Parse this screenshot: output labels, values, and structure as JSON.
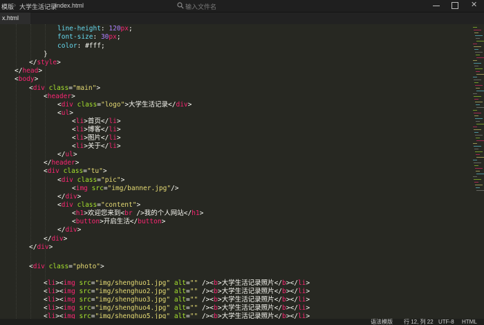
{
  "breadcrumb": {
    "items": [
      "模版",
      "大学生活记录",
      "index.html"
    ]
  },
  "search": {
    "placeholder": "输入文件名"
  },
  "tabs": [
    {
      "label": "x.html"
    }
  ],
  "code_lines": [
    [
      [
        "prop",
        "line-height"
      ],
      [
        "txt",
        ": "
      ],
      [
        "num",
        "120"
      ],
      [
        "tag",
        "px"
      ],
      [
        "txt",
        ";"
      ]
    ],
    [
      [
        "prop",
        "font-size"
      ],
      [
        "txt",
        ": "
      ],
      [
        "num",
        "30"
      ],
      [
        "tag",
        "px"
      ],
      [
        "txt",
        ";"
      ]
    ],
    [
      [
        "prop",
        "color"
      ],
      [
        "txt",
        ": "
      ],
      [
        "txt",
        "#fff"
      ],
      [
        "txt",
        ";"
      ]
    ],
    [
      [
        "txt",
        "}"
      ]
    ],
    [
      [
        "txt",
        "</"
      ],
      [
        "tag",
        "style"
      ],
      [
        "txt",
        ">"
      ]
    ],
    [
      [
        "txt",
        "</"
      ],
      [
        "tag",
        "head"
      ],
      [
        "txt",
        ">"
      ]
    ],
    [
      [
        "txt",
        "<"
      ],
      [
        "tag",
        "body"
      ],
      [
        "txt",
        ">"
      ]
    ],
    [
      [
        "txt",
        "<"
      ],
      [
        "tag",
        "div"
      ],
      [
        "txt",
        " "
      ],
      [
        "attr",
        "class"
      ],
      [
        "txt",
        "="
      ],
      [
        "str",
        "\"main\""
      ],
      [
        "txt",
        ">"
      ]
    ],
    [
      [
        "txt",
        "<"
      ],
      [
        "tag",
        "header"
      ],
      [
        "txt",
        ">"
      ]
    ],
    [
      [
        "txt",
        "<"
      ],
      [
        "tag",
        "div"
      ],
      [
        "txt",
        " "
      ],
      [
        "attr",
        "class"
      ],
      [
        "txt",
        "="
      ],
      [
        "str",
        "\"logo\""
      ],
      [
        "txt",
        ">大学生活记录</"
      ],
      [
        "tag",
        "div"
      ],
      [
        "txt",
        ">"
      ]
    ],
    [
      [
        "txt",
        "<"
      ],
      [
        "tag",
        "ul"
      ],
      [
        "txt",
        ">"
      ]
    ],
    [
      [
        "txt",
        "<"
      ],
      [
        "tag",
        "li"
      ],
      [
        "txt",
        ">首页</"
      ],
      [
        "tag",
        "li"
      ],
      [
        "txt",
        ">"
      ]
    ],
    [
      [
        "txt",
        "<"
      ],
      [
        "tag",
        "li"
      ],
      [
        "txt",
        ">博客</"
      ],
      [
        "tag",
        "li"
      ],
      [
        "txt",
        ">"
      ]
    ],
    [
      [
        "txt",
        "<"
      ],
      [
        "tag",
        "li"
      ],
      [
        "txt",
        ">图片</"
      ],
      [
        "tag",
        "li"
      ],
      [
        "txt",
        ">"
      ]
    ],
    [
      [
        "txt",
        "<"
      ],
      [
        "tag",
        "li"
      ],
      [
        "txt",
        ">关于</"
      ],
      [
        "tag",
        "li"
      ],
      [
        "txt",
        ">"
      ]
    ],
    [
      [
        "txt",
        "</"
      ],
      [
        "tag",
        "ul"
      ],
      [
        "txt",
        ">"
      ]
    ],
    [
      [
        "txt",
        "</"
      ],
      [
        "tag",
        "header"
      ],
      [
        "txt",
        ">"
      ]
    ],
    [
      [
        "txt",
        "<"
      ],
      [
        "tag",
        "div"
      ],
      [
        "txt",
        " "
      ],
      [
        "attr",
        "class"
      ],
      [
        "txt",
        "="
      ],
      [
        "str",
        "\"tu\""
      ],
      [
        "txt",
        ">"
      ]
    ],
    [
      [
        "txt",
        "<"
      ],
      [
        "tag",
        "div"
      ],
      [
        "txt",
        " "
      ],
      [
        "attr",
        "class"
      ],
      [
        "txt",
        "="
      ],
      [
        "str",
        "\"pic\""
      ],
      [
        "txt",
        ">"
      ]
    ],
    [
      [
        "txt",
        "<"
      ],
      [
        "tag",
        "img"
      ],
      [
        "txt",
        " "
      ],
      [
        "attr",
        "src"
      ],
      [
        "txt",
        "="
      ],
      [
        "str",
        "\"img/banner.jpg\""
      ],
      [
        "txt",
        "/>"
      ]
    ],
    [
      [
        "txt",
        "</"
      ],
      [
        "tag",
        "div"
      ],
      [
        "txt",
        ">"
      ]
    ],
    [
      [
        "txt",
        "<"
      ],
      [
        "tag",
        "div"
      ],
      [
        "txt",
        " "
      ],
      [
        "attr",
        "class"
      ],
      [
        "txt",
        "="
      ],
      [
        "str",
        "\"content\""
      ],
      [
        "txt",
        ">"
      ]
    ],
    [
      [
        "txt",
        "<"
      ],
      [
        "tag",
        "h1"
      ],
      [
        "txt",
        ">欢迎您来到<"
      ],
      [
        "tag",
        "br"
      ],
      [
        "txt",
        " />我的个人网站</"
      ],
      [
        "tag",
        "h1"
      ],
      [
        "txt",
        ">"
      ]
    ],
    [
      [
        "txt",
        "<"
      ],
      [
        "tag",
        "button"
      ],
      [
        "txt",
        ">开启生活</"
      ],
      [
        "tag",
        "button"
      ],
      [
        "txt",
        ">"
      ]
    ],
    [
      [
        "txt",
        "</"
      ],
      [
        "tag",
        "div"
      ],
      [
        "txt",
        ">"
      ]
    ],
    [
      [
        "txt",
        "</"
      ],
      [
        "tag",
        "div"
      ],
      [
        "txt",
        ">"
      ]
    ],
    [
      [
        "txt",
        "</"
      ],
      [
        "tag",
        "div"
      ],
      [
        "txt",
        ">"
      ]
    ],
    [],
    [
      [
        "txt",
        "<"
      ],
      [
        "tag",
        "div"
      ],
      [
        "txt",
        " "
      ],
      [
        "attr",
        "class"
      ],
      [
        "txt",
        "="
      ],
      [
        "str",
        "\"photo\""
      ],
      [
        "txt",
        ">"
      ]
    ],
    [],
    [
      [
        "txt",
        "<"
      ],
      [
        "tag",
        "li"
      ],
      [
        "txt",
        "><"
      ],
      [
        "tag",
        "img"
      ],
      [
        "txt",
        " "
      ],
      [
        "attr",
        "src"
      ],
      [
        "txt",
        "="
      ],
      [
        "str",
        "\"img/shenghuo1.jpg\""
      ],
      [
        "txt",
        " "
      ],
      [
        "attr",
        "alt"
      ],
      [
        "txt",
        "="
      ],
      [
        "str",
        "\"\""
      ],
      [
        "txt",
        " /><"
      ],
      [
        "tag",
        "b"
      ],
      [
        "txt",
        ">大学生活记录照片</"
      ],
      [
        "tag",
        "b"
      ],
      [
        "txt",
        "></"
      ],
      [
        "tag",
        "li"
      ],
      [
        "txt",
        ">"
      ]
    ],
    [
      [
        "txt",
        "<"
      ],
      [
        "tag",
        "li"
      ],
      [
        "txt",
        "><"
      ],
      [
        "tag",
        "img"
      ],
      [
        "txt",
        " "
      ],
      [
        "attr",
        "src"
      ],
      [
        "txt",
        "="
      ],
      [
        "str",
        "\"img/shenghuo2.jpg\""
      ],
      [
        "txt",
        " "
      ],
      [
        "attr",
        "alt"
      ],
      [
        "txt",
        "="
      ],
      [
        "str",
        "\"\""
      ],
      [
        "txt",
        " /><"
      ],
      [
        "tag",
        "b"
      ],
      [
        "txt",
        ">大学生活记录照片</"
      ],
      [
        "tag",
        "b"
      ],
      [
        "txt",
        "></"
      ],
      [
        "tag",
        "li"
      ],
      [
        "txt",
        ">"
      ]
    ],
    [
      [
        "txt",
        "<"
      ],
      [
        "tag",
        "li"
      ],
      [
        "txt",
        "><"
      ],
      [
        "tag",
        "img"
      ],
      [
        "txt",
        " "
      ],
      [
        "attr",
        "src"
      ],
      [
        "txt",
        "="
      ],
      [
        "str",
        "\"img/shenghuo3.jpg\""
      ],
      [
        "txt",
        " "
      ],
      [
        "attr",
        "alt"
      ],
      [
        "txt",
        "="
      ],
      [
        "str",
        "\"\""
      ],
      [
        "txt",
        " /><"
      ],
      [
        "tag",
        "b"
      ],
      [
        "txt",
        ">大学生活记录照片</"
      ],
      [
        "tag",
        "b"
      ],
      [
        "txt",
        "></"
      ],
      [
        "tag",
        "li"
      ],
      [
        "txt",
        ">"
      ]
    ],
    [
      [
        "txt",
        "<"
      ],
      [
        "tag",
        "li"
      ],
      [
        "txt",
        "><"
      ],
      [
        "tag",
        "img"
      ],
      [
        "txt",
        " "
      ],
      [
        "attr",
        "src"
      ],
      [
        "txt",
        "="
      ],
      [
        "str",
        "\"img/shenghuo4.jpg\""
      ],
      [
        "txt",
        " "
      ],
      [
        "attr",
        "alt"
      ],
      [
        "txt",
        "="
      ],
      [
        "str",
        "\"\""
      ],
      [
        "txt",
        " /><"
      ],
      [
        "tag",
        "b"
      ],
      [
        "txt",
        ">大学生活记录照片</"
      ],
      [
        "tag",
        "b"
      ],
      [
        "txt",
        "></"
      ],
      [
        "tag",
        "li"
      ],
      [
        "txt",
        ">"
      ]
    ],
    [
      [
        "txt",
        "<"
      ],
      [
        "tag",
        "li"
      ],
      [
        "txt",
        "><"
      ],
      [
        "tag",
        "img"
      ],
      [
        "txt",
        " "
      ],
      [
        "attr",
        "src"
      ],
      [
        "txt",
        "="
      ],
      [
        "str",
        "\"img/shenghuo5.jpg\""
      ],
      [
        "txt",
        " "
      ],
      [
        "attr",
        "alt"
      ],
      [
        "txt",
        "="
      ],
      [
        "str",
        "\"\""
      ],
      [
        "txt",
        " /><"
      ],
      [
        "tag",
        "b"
      ],
      [
        "txt",
        ">大学生活记录照片</"
      ],
      [
        "tag",
        "b"
      ],
      [
        "txt",
        "></"
      ],
      [
        "tag",
        "li"
      ],
      [
        "txt",
        ">"
      ]
    ]
  ],
  "status": {
    "mode": "语法模版",
    "position": "行 12, 列 22",
    "encoding": "UTF-8",
    "syntax": "HTML"
  },
  "colors": {
    "background": "#272822",
    "tag": "#f92672",
    "attribute": "#a6e22e",
    "string": "#e6db74",
    "number": "#ae81ff",
    "property": "#66d9ef",
    "text": "#f8f8f2"
  }
}
